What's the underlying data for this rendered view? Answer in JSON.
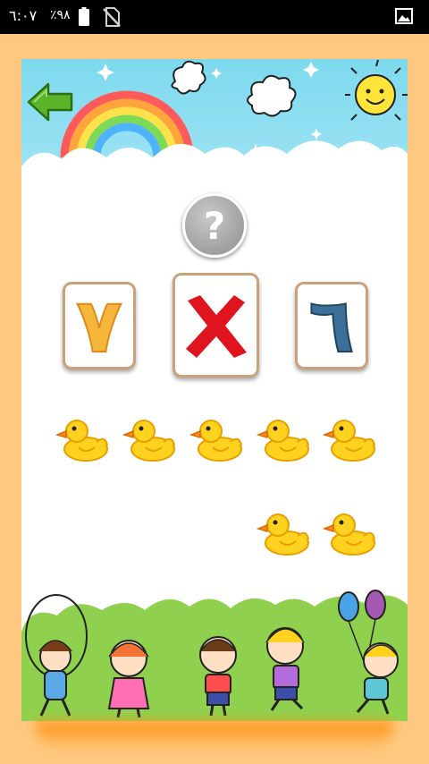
{
  "status_bar": {
    "time": "٦:٠٧",
    "battery_percent": "٪٩٨",
    "icons": [
      "battery-icon",
      "no-sim-icon",
      "image-notification-icon"
    ]
  },
  "game": {
    "question_mark": "?",
    "answer_cards": [
      {
        "value": "٧",
        "state": "option"
      },
      {
        "value": "",
        "state": "wrong-x"
      },
      {
        "value": "٦",
        "state": "option"
      }
    ],
    "duck_count": 7,
    "colors": {
      "background": "#ffc880",
      "sky": "#7dd9ee",
      "ground": "#8fd14f",
      "wrong_mark": "#e0141e",
      "back_arrow": "#5cb42a"
    }
  }
}
